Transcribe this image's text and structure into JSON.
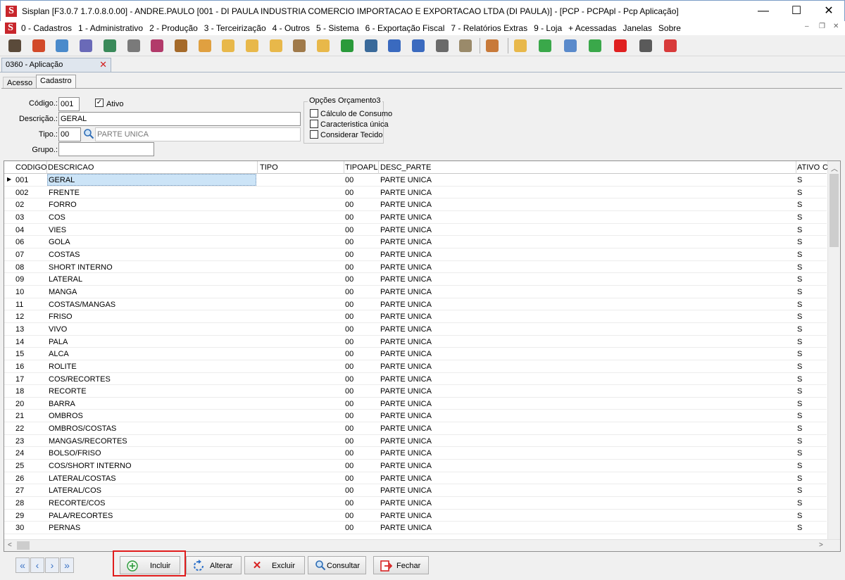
{
  "window": {
    "title": "Sisplan [F3.0.7 1.7.0.8.0.00] - ANDRE.PAULO [001 - DI PAULA INDUSTRIA COMERCIO IMPORTACAO E EXPORTACAO LTDA (DI PAULA)] - [PCP - PCPApl - Pcp Aplicação]",
    "minimize": "—",
    "maximize": "☐",
    "close": "✕",
    "logo": "S"
  },
  "menu": {
    "items": [
      "0 - Cadastros",
      "1 - Administrativo",
      "2 - Produção",
      "3 - Terceirização",
      "4 - Outros",
      "5 - Sistema",
      "6 - Exportação Fiscal",
      "7 - Relatórios Extras",
      "9 - Loja",
      "+ Acessadas",
      "Janelas",
      "Sobre"
    ],
    "mdi_min": "–",
    "mdi_restore": "❐",
    "mdi_close": "✕"
  },
  "toolbar": {
    "icons": [
      "binoculars-icon",
      "strawberry-icon",
      "notes-icon",
      "gear-icon",
      "tools-icon",
      "printer-icon",
      "cocktail-icon",
      "box-icon",
      "report-icon",
      "folder-icon",
      "folder-icon",
      "folder-icon",
      "documents-icon",
      "folder-icon",
      "check-icon",
      "chart-icon",
      "export-icon",
      "export-icon",
      "battery-icon",
      "book-icon",
      "users-icon",
      "folder-open-icon",
      "whatsapp-icon",
      "monitor-icon",
      "checkmark-icon",
      "power-icon",
      "calculator-icon",
      "exit-icon"
    ]
  },
  "document_tab": {
    "label": "0360 - Aplicação",
    "close": "✕"
  },
  "tabs": {
    "acesso": "Acesso",
    "cadastro": "Cadastro"
  },
  "form": {
    "codigo_label": "Código.:",
    "codigo_value": "001",
    "ativo_label": "Ativo",
    "ativo_checked": "✓",
    "descricao_label": "Descrição.:",
    "descricao_value": "GERAL",
    "tipo_label": "Tipo.:",
    "tipo_value": "00",
    "tipo_desc": "PARTE UNICA",
    "grupo_label": "Grupo.:",
    "grupo_value": ""
  },
  "options": {
    "title": "Opções Orçamento3",
    "items": [
      "Cálculo de Consumo",
      "Caracteristica única",
      "Considerar Tecido"
    ]
  },
  "grid": {
    "columns": [
      "CODIGO",
      "DESCRICAO",
      "TIPO",
      "TIPOAPL",
      "DESC_PARTE",
      "ATIVO",
      "C"
    ],
    "rows": [
      [
        "001",
        "GERAL",
        "",
        "00",
        "PARTE UNICA",
        "S"
      ],
      [
        "002",
        "FRENTE",
        "",
        "00",
        "PARTE UNICA",
        "S"
      ],
      [
        "02",
        "FORRO",
        "",
        "00",
        "PARTE UNICA",
        "S"
      ],
      [
        "03",
        "COS",
        "",
        "00",
        "PARTE UNICA",
        "S"
      ],
      [
        "04",
        "VIES",
        "",
        "00",
        "PARTE UNICA",
        "S"
      ],
      [
        "06",
        "GOLA",
        "",
        "00",
        "PARTE UNICA",
        "S"
      ],
      [
        "07",
        "COSTAS",
        "",
        "00",
        "PARTE UNICA",
        "S"
      ],
      [
        "08",
        "SHORT INTERNO",
        "",
        "00",
        "PARTE UNICA",
        "S"
      ],
      [
        "09",
        "LATERAL",
        "",
        "00",
        "PARTE UNICA",
        "S"
      ],
      [
        "10",
        "MANGA",
        "",
        "00",
        "PARTE UNICA",
        "S"
      ],
      [
        "11",
        "COSTAS/MANGAS",
        "",
        "00",
        "PARTE UNICA",
        "S"
      ],
      [
        "12",
        "FRISO",
        "",
        "00",
        "PARTE UNICA",
        "S"
      ],
      [
        "13",
        "VIVO",
        "",
        "00",
        "PARTE UNICA",
        "S"
      ],
      [
        "14",
        "PALA",
        "",
        "00",
        "PARTE UNICA",
        "S"
      ],
      [
        "15",
        "ALCA",
        "",
        "00",
        "PARTE UNICA",
        "S"
      ],
      [
        "16",
        "ROLITE",
        "",
        "00",
        "PARTE UNICA",
        "S"
      ],
      [
        "17",
        "COS/RECORTES",
        "",
        "00",
        "PARTE UNICA",
        "S"
      ],
      [
        "18",
        "RECORTE",
        "",
        "00",
        "PARTE UNICA",
        "S"
      ],
      [
        "20",
        "BARRA",
        "",
        "00",
        "PARTE UNICA",
        "S"
      ],
      [
        "21",
        "OMBROS",
        "",
        "00",
        "PARTE UNICA",
        "S"
      ],
      [
        "22",
        "OMBROS/COSTAS",
        "",
        "00",
        "PARTE UNICA",
        "S"
      ],
      [
        "23",
        "MANGAS/RECORTES",
        "",
        "00",
        "PARTE UNICA",
        "S"
      ],
      [
        "24",
        "BOLSO/FRISO",
        "",
        "00",
        "PARTE UNICA",
        "S"
      ],
      [
        "25",
        "COS/SHORT INTERNO",
        "",
        "00",
        "PARTE UNICA",
        "S"
      ],
      [
        "26",
        "LATERAL/COSTAS",
        "",
        "00",
        "PARTE UNICA",
        "S"
      ],
      [
        "27",
        "LATERAL/COS",
        "",
        "00",
        "PARTE UNICA",
        "S"
      ],
      [
        "28",
        "RECORTE/COS",
        "",
        "00",
        "PARTE UNICA",
        "S"
      ],
      [
        "29",
        "PALA/RECORTES",
        "",
        "00",
        "PARTE UNICA",
        "S"
      ],
      [
        "30",
        "PERNAS",
        "",
        "00",
        "PARTE UNICA",
        "S"
      ]
    ],
    "selected_row": 0
  },
  "nav": {
    "first": "«",
    "prev": "‹",
    "next": "›",
    "last": "»"
  },
  "actions": {
    "incluir": "Incluir",
    "alterar": "Alterar",
    "excluir": "Excluir",
    "consultar": "Consultar",
    "fechar": "Fechar"
  },
  "colors": {
    "accent_red": "#e01c1c",
    "selection": "#cce4f7",
    "logo_red": "#c8262c"
  }
}
